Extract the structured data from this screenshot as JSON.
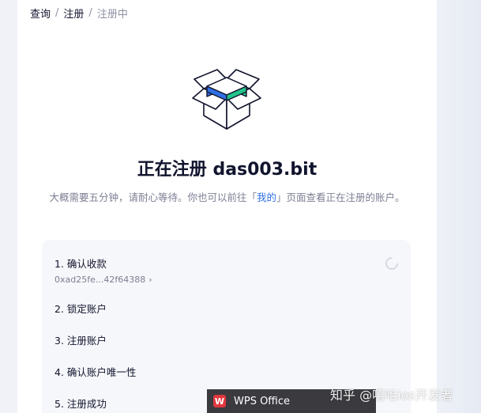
{
  "breadcrumb": {
    "items": [
      "查询",
      "注册"
    ],
    "current": "注册中",
    "separator": "/"
  },
  "header": {
    "title": "正在注册 das003.bit"
  },
  "description": {
    "before": "大概需要五分钟，请耐心等待。你也可以前往「",
    "link": "我的",
    "after": "」页面查看正在注册的账户。"
  },
  "steps": [
    {
      "label": "1. 确认收款",
      "detail": "0xad25fe...42f64388",
      "status": "loading"
    },
    {
      "label": "2. 锁定账户"
    },
    {
      "label": "3. 注册账户"
    },
    {
      "label": "4. 确认账户唯一性"
    },
    {
      "label": "5. 注册成功"
    }
  ],
  "taskbar": {
    "app_label": "WPS Office",
    "app_icon": "wps-icon"
  },
  "watermark": "知乎 @嘻哈ios开发者",
  "colors": {
    "accent_blue": "#2f6fe4",
    "accent_green": "#22c58b",
    "text_primary": "#11142d",
    "text_secondary": "#7c7f93"
  }
}
